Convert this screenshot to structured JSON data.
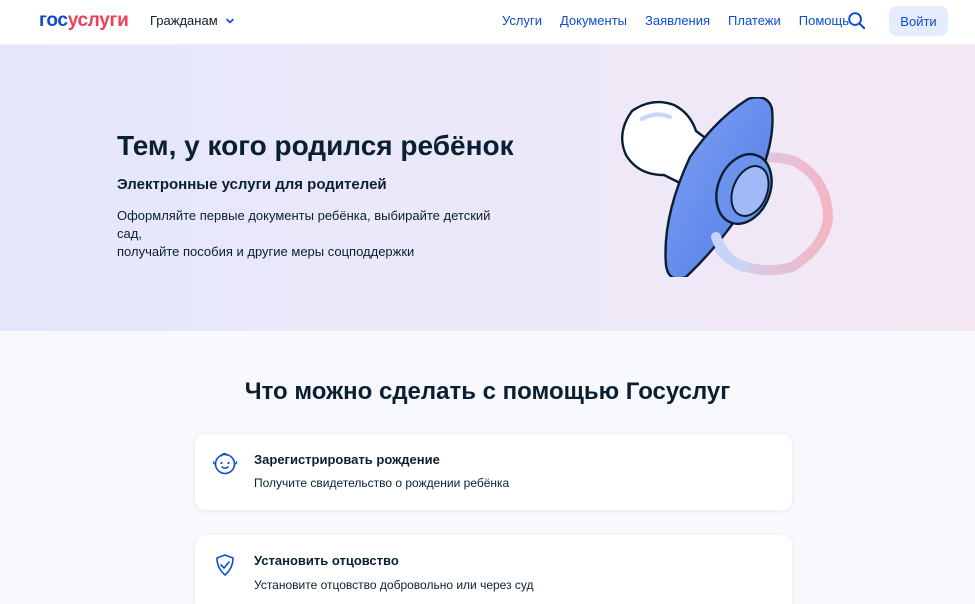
{
  "header": {
    "logo_part1": "гос",
    "logo_part2": "услуги",
    "audience": "Гражданам",
    "nav": [
      "Услуги",
      "Документы",
      "Заявления",
      "Платежи",
      "Помощь"
    ],
    "login_label": "Войти"
  },
  "hero": {
    "title": "Тем, у кого родился ребёнок",
    "subtitle": "Электронные услуги для родителей",
    "description_lines": [
      "Оформляйте первые документы ребёнка, выбирайте детский сад,",
      "получайте пособия и другие меры соцподдержки"
    ],
    "illustration": "pacifier"
  },
  "services": {
    "title": "Что можно сделать с помощью Госуслуг",
    "items": [
      {
        "icon": "baby-face-icon",
        "title": "Зарегистрировать рождение",
        "description": "Получите свидетельство о рождении ребёнка"
      },
      {
        "icon": "shield-icon",
        "title": "Установить отцовство",
        "description": "Установите отцовство добровольно или через суд"
      }
    ]
  },
  "colors": {
    "brand_blue": "#0d4cd3",
    "brand_red": "#ee3f58",
    "text_dark": "#0b1f33",
    "button_bg": "#e4ecfd"
  }
}
